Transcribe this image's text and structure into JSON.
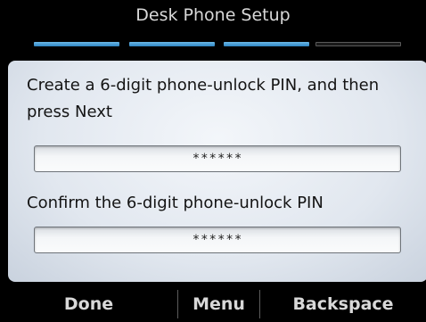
{
  "header": {
    "title": "Desk Phone Setup"
  },
  "progress": {
    "steps_total": 4,
    "steps_completed": 3,
    "completed_color": "#3a92cf"
  },
  "form": {
    "create_prompt": "Create a 6-digit phone-unlock PIN, and then press Next",
    "create_pin_value": "******",
    "confirm_prompt": "Confirm the 6-digit phone-unlock PIN",
    "confirm_pin_value": "******"
  },
  "softkeys": {
    "done_label": "Done",
    "menu_label": "Menu",
    "backspace_label": "Backspace"
  }
}
